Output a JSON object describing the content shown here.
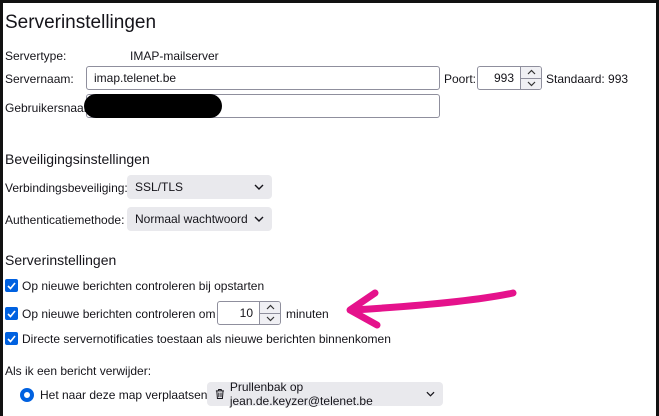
{
  "page": {
    "title": "Serverinstellingen"
  },
  "server": {
    "type_label": "Servertype:",
    "type_value": "IMAP-mailserver",
    "name_label": "Servernaam:",
    "name_value": "imap.telenet.be",
    "port_label": "Poort:",
    "port_value": "993",
    "default_label": "Standaard: 993",
    "username_label": "Gebruikersnaam:",
    "username_value": ""
  },
  "security": {
    "title": "Beveiligingsinstellingen",
    "connection_label": "Verbindingsbeveiliging:",
    "connection_value": "SSL/TLS",
    "auth_label": "Authenticatiemethode:",
    "auth_value": "Normaal wachtwoord"
  },
  "settings": {
    "title": "Serverinstellingen",
    "check_startup_label": "Op nieuwe berichten controleren bij opstarten",
    "check_startup_checked": true,
    "check_every_label": "Op nieuwe berichten controleren om de",
    "check_every_checked": true,
    "check_every_value": "10",
    "minutes_label": "minuten",
    "push_label": "Directe servernotificaties toestaan als nieuwe berichten binnenkomen",
    "push_checked": true
  },
  "delete": {
    "label": "Als ik een bericht verwijder:",
    "move_option_label": "Het naar deze map verplaatsen:",
    "move_option_selected": true,
    "folder_value": "Prullenbak op jean.de.keyzer@telenet.be"
  },
  "annotation": {
    "arrow_color": "#e5128c"
  },
  "colors": {
    "accent": "#0061e0",
    "text": "#15141a"
  }
}
